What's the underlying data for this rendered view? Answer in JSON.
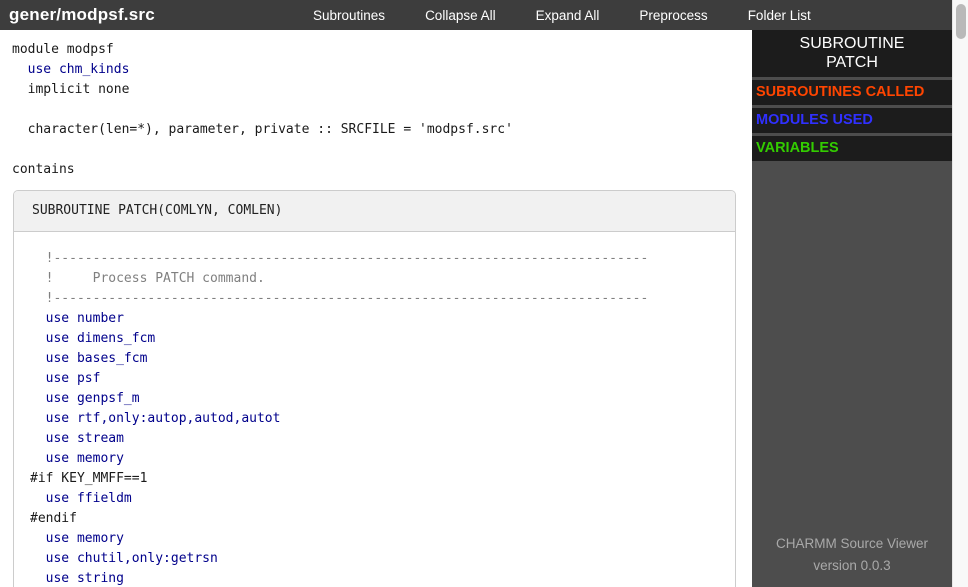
{
  "topbar": {
    "title": "gener/modpsf.src",
    "menu": [
      {
        "label": "Subroutines"
      },
      {
        "label": "Collapse All"
      },
      {
        "label": "Expand All"
      },
      {
        "label": "Preprocess"
      },
      {
        "label": "Folder List"
      }
    ]
  },
  "code": {
    "top_lines": [
      {
        "text": "module modpsf",
        "type": "plain"
      },
      {
        "text": "  use chm_kinds",
        "type": "use"
      },
      {
        "text": "  implicit none",
        "type": "plain"
      },
      {
        "text": "",
        "type": "plain"
      },
      {
        "text": "  character(len=*), parameter, private :: SRCFILE = 'modpsf.src'",
        "type": "plain"
      },
      {
        "text": "",
        "type": "plain"
      },
      {
        "text": "contains",
        "type": "plain"
      }
    ],
    "subroutine": {
      "signature": "SUBROUTINE PATCH(COMLYN, COMLEN)",
      "body_lines": [
        {
          "text": "  !----------------------------------------------------------------------------",
          "type": "comment"
        },
        {
          "text": "  !     Process PATCH command.",
          "type": "comment"
        },
        {
          "text": "  !----------------------------------------------------------------------------",
          "type": "comment"
        },
        {
          "text": "  use number",
          "type": "use"
        },
        {
          "text": "  use dimens_fcm",
          "type": "use"
        },
        {
          "text": "  use bases_fcm",
          "type": "use"
        },
        {
          "text": "  use psf",
          "type": "use"
        },
        {
          "text": "  use genpsf_m",
          "type": "use"
        },
        {
          "text": "  use rtf,only:autop,autod,autot",
          "type": "use"
        },
        {
          "text": "  use stream",
          "type": "use"
        },
        {
          "text": "  use memory",
          "type": "use"
        },
        {
          "text": "#if KEY_MMFF==1",
          "type": "directive"
        },
        {
          "text": "  use ffieldm",
          "type": "use"
        },
        {
          "text": "#endif",
          "type": "directive"
        },
        {
          "text": "  use memory",
          "type": "use"
        },
        {
          "text": "  use chutil,only:getrsn",
          "type": "use"
        },
        {
          "text": "  use string",
          "type": "use"
        }
      ]
    }
  },
  "sidebar": {
    "title_line1": "SUBROUTINE",
    "title_line2": "PATCH",
    "sections": [
      {
        "label": "SUBROUTINES CALLED",
        "color": "#ff4500"
      },
      {
        "label": "MODULES USED",
        "color": "#3030ff"
      },
      {
        "label": "VARIABLES",
        "color": "#33cc00"
      }
    ],
    "footer_line1": "CHARMM Source Viewer",
    "footer_line2": "version 0.0.3"
  },
  "colors": {
    "topbar_bg": "#3d3d3d",
    "sidebar_bg": "#4d4d4d",
    "sidebar_block_bg": "#1c1c1c",
    "use_statement": "#00008b",
    "comment": "#808080",
    "box_header_bg": "#f1f1f1",
    "box_border": "#cccccc"
  }
}
